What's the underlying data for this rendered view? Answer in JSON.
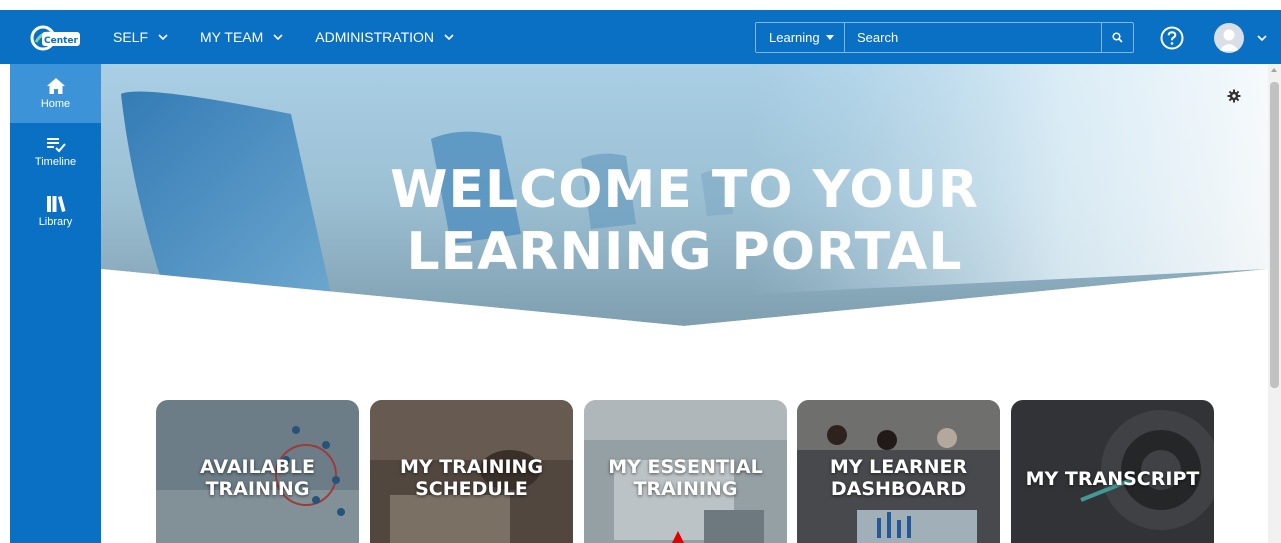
{
  "colors": {
    "brand": "#0a70c4",
    "sidebar_active": "#3d93d8"
  },
  "header": {
    "logo_text": "Center",
    "nav": [
      {
        "label": "SELF"
      },
      {
        "label": "MY TEAM"
      },
      {
        "label": "ADMINISTRATION"
      }
    ],
    "search": {
      "scope": "Learning",
      "placeholder": "Search"
    },
    "help_icon": "help-circle-icon",
    "avatar_icon": "user-avatar-icon"
  },
  "sidebar": {
    "items": [
      {
        "label": "Home",
        "icon": "home-icon",
        "active": true
      },
      {
        "label": "Timeline",
        "icon": "timeline-icon",
        "active": false
      },
      {
        "label": "Library",
        "icon": "library-icon",
        "active": false
      }
    ]
  },
  "hero": {
    "title_line1": "WELCOME TO YOUR",
    "title_line2": "LEARNING PORTAL"
  },
  "tiles": [
    {
      "label": "AVAILABLE\nTRAINING"
    },
    {
      "label": "MY TRAINING\nSCHEDULE"
    },
    {
      "label": "MY ESSENTIAL\nTRAINING"
    },
    {
      "label": "MY LEARNER\nDASHBOARD"
    },
    {
      "label": "MY TRANSCRIPT"
    }
  ]
}
